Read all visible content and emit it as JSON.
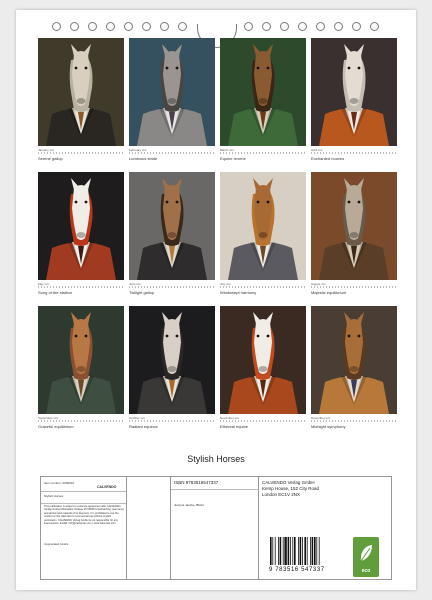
{
  "calendar": {
    "title": "Stylish Horses",
    "months": [
      {
        "month": "January xxx",
        "caption": "Serene gallop",
        "colors": {
          "bg": "#3f3a2a",
          "head": "#d9cfbe",
          "mane": "#b8b0a0",
          "coat": "#2a2622",
          "shirt": "#e8e4da",
          "tie": "#8a5a2a"
        }
      },
      {
        "month": "February xxx",
        "caption": "Luminous stride",
        "colors": {
          "bg": "#35505e",
          "head": "#9a9590",
          "mane": "#4a4540",
          "coat": "#8a8886",
          "shirt": "#e6e6e6",
          "tie": "#4a3e50"
        }
      },
      {
        "month": "March xxx",
        "caption": "Equine reverie",
        "colors": {
          "bg": "#2e4a2c",
          "head": "#8a5a30",
          "mane": "#3a2614",
          "coat": "#3e6a3a",
          "shirt": "#d8d0bc",
          "tie": "#6a3a1a"
        }
      },
      {
        "month": "April xxx",
        "caption": "Enchanted hooves",
        "colors": {
          "bg": "#3a3030",
          "head": "#e2dcd2",
          "mane": "#c4bcb0",
          "coat": "#b8581e",
          "shirt": "#f0ece4",
          "tie": "#6a2a1a"
        }
      },
      {
        "month": "May xxx",
        "caption": "Song of the stallion",
        "colors": {
          "bg": "#1e1c1c",
          "head": "#f0ece6",
          "mane": "#b8361a",
          "coat": "#a03a20",
          "shirt": "#f4f0ea",
          "tie": "#3a1a12"
        }
      },
      {
        "month": "June xxx",
        "caption": "Twilight gallop",
        "colors": {
          "bg": "#6a6866",
          "head": "#a0704a",
          "mane": "#3a2818",
          "coat": "#2e2c2c",
          "shirt": "#e0d8cc",
          "tie": "#b07a3a"
        }
      },
      {
        "month": "July xxx",
        "caption": "Windswept harmony",
        "colors": {
          "bg": "#d8cfc4",
          "head": "#a86a34",
          "mane": "#b8742e",
          "coat": "#5a5a60",
          "shirt": "#f0ebe4",
          "tie": "#6a4a2a"
        }
      },
      {
        "month": "August xxx",
        "caption": "Majestic equilibrium",
        "colors": {
          "bg": "#7a4a2a",
          "head": "#b8aa96",
          "mane": "#6a5a4a",
          "coat": "#5a3e28",
          "shirt": "#d8ccb8",
          "tie": "#3a2818"
        }
      },
      {
        "month": "September xxx",
        "caption": "Graceful equilibrium",
        "colors": {
          "bg": "#2e3a30",
          "head": "#b87846",
          "mane": "#8a5030",
          "coat": "#3e4e40",
          "shirt": "#d8d0c0",
          "tie": "#6a4a2a"
        }
      },
      {
        "month": "October xxx",
        "caption": "Radiant equinox",
        "colors": {
          "bg": "#1c1c1e",
          "head": "#d8d0c6",
          "mane": "#2a2624",
          "coat": "#3a3836",
          "shirt": "#e8e2d8",
          "tie": "#a86a2a"
        }
      },
      {
        "month": "November xxx",
        "caption": "Ethereal equine",
        "colors": {
          "bg": "#3a2a22",
          "head": "#f0ece6",
          "mane": "#c24a1c",
          "coat": "#a8481c",
          "shirt": "#f2ede4",
          "tie": "#5a2a16"
        }
      },
      {
        "month": "December xxx",
        "caption": "Midnight symphony",
        "colors": {
          "bg": "#4a3e34",
          "head": "#a86e3a",
          "mane": "#5a3a20",
          "coat": "#b8783a",
          "shirt": "#e6ddd0",
          "tie": "#3a3a5a"
        }
      }
    ]
  },
  "info": {
    "item_number_label": "Item number: 2069910",
    "item_name": "Stylish Horses",
    "logo_text": "CALVENDO",
    "copyright_text": "This publication is subject to a license agreement with CALVENDO Verlag GmbH (Wickrather Strasse 25 53606 Unterhaching, Germany) and all licensed material of its licensors. It is prohibited to use the content of this calendar for commercial use without explicit permission. CALVENDO Verlag GmbH is not responsible for any inaccuracies. E-Mail: info@calvendo.com / www.calvendo.com",
    "ai_note": "AI-generated content",
    "isbn": "ISBN 9783516547337",
    "author": "Justyna Jaszke JBJart",
    "publisher_name": "CALVENDO Verlag GmbH",
    "publisher_address_1": "Kemp House, 152 City Road",
    "publisher_address_2": "London EC1V 2NX",
    "barcode_number": "9 783516 547337",
    "eco_label": "eco"
  }
}
